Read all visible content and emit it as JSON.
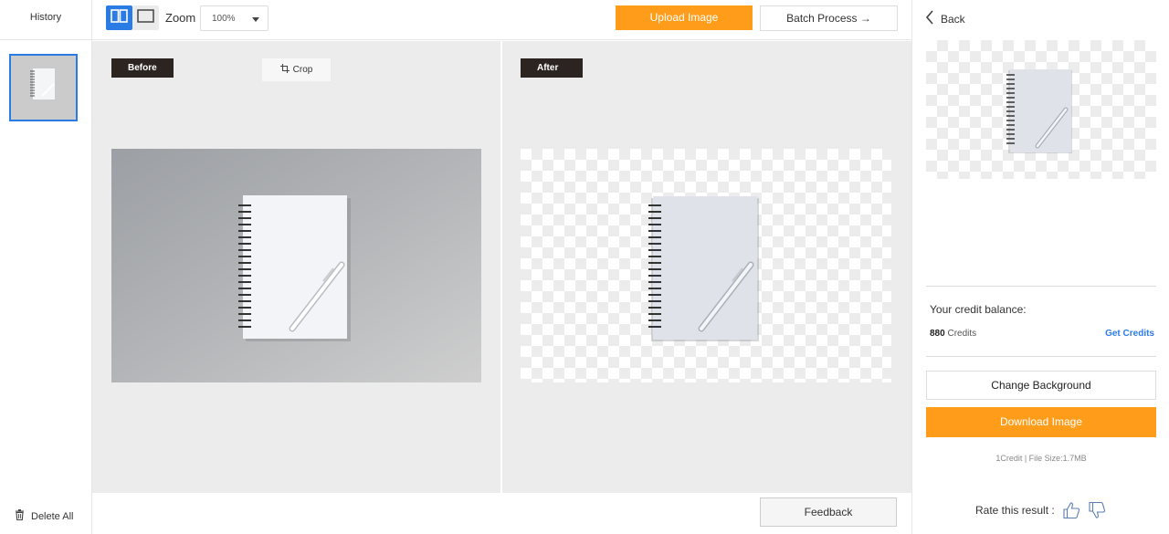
{
  "history": {
    "title": "History",
    "delete_all_label": "Delete All"
  },
  "toolbar": {
    "zoom_label": "Zoom",
    "zoom_value": "100%",
    "upload_label": "Upload Image",
    "batch_label": "Batch Process →",
    "active_view": "split"
  },
  "canvas": {
    "before_label": "Before",
    "after_label": "After",
    "crop_label": "Crop"
  },
  "bottom": {
    "feedback_label": "Feedback"
  },
  "right_panel": {
    "back_label": "Back",
    "credit_balance_label": "Your credit balance:",
    "credits_number": "880",
    "credits_unit": " Credits",
    "get_credits_label": "Get Credits",
    "change_background_label": "Change Background",
    "download_label": "Download Image",
    "file_info": "1Credit | File Size:1.7MB",
    "rate_label": "Rate this result :"
  },
  "colors": {
    "accent_blue": "#2a7be4",
    "accent_orange": "#ff9d1b",
    "tag_dark": "#2b2421",
    "canvas_bg": "#ececec"
  },
  "icons": [
    "split-view-icon",
    "single-view-icon",
    "chevron-down-icon",
    "crop-icon",
    "trash-icon",
    "chevron-left-icon",
    "thumbs-up-icon",
    "thumbs-down-icon"
  ]
}
